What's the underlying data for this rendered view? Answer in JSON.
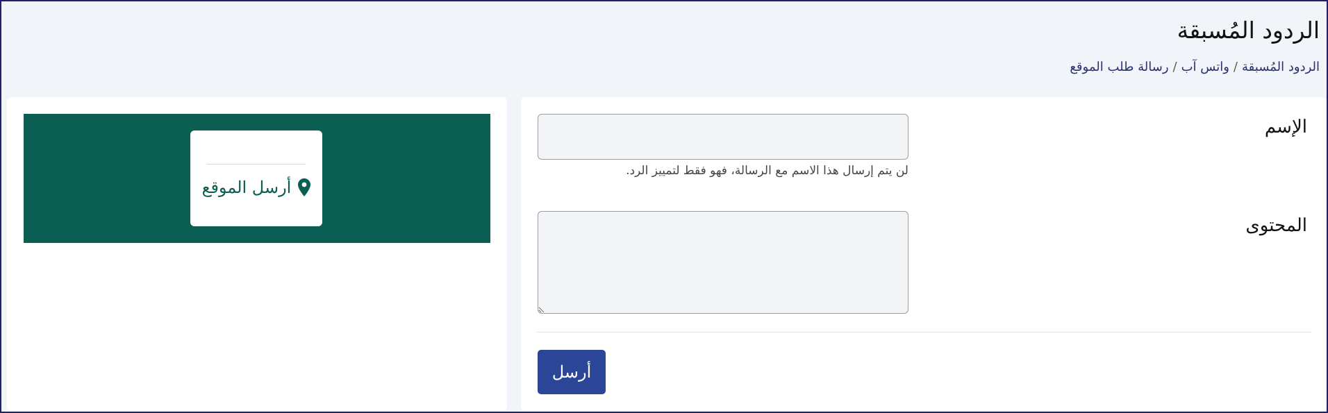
{
  "page": {
    "title": "الردود المُسبقة"
  },
  "breadcrumb": {
    "items": [
      "الردود المُسبقة",
      "واتس آب",
      "رسالة طلب الموقع"
    ],
    "separator": "/"
  },
  "form": {
    "name_label": "الإسم",
    "name_value": "",
    "name_help": "لن يتم إرسال هذا الاسم مع الرسالة، فهو فقط لتمييز الرد.",
    "content_label": "المحتوى",
    "content_value": "",
    "submit_label": "أرسل"
  },
  "preview": {
    "action_label": "أرسل الموقع",
    "action_icon": "location-pin-icon"
  },
  "colors": {
    "primary_button": "#2c4697",
    "preview_background": "#0a5e52",
    "preview_accent": "#0a5e52",
    "page_background": "#f1f4f8"
  }
}
